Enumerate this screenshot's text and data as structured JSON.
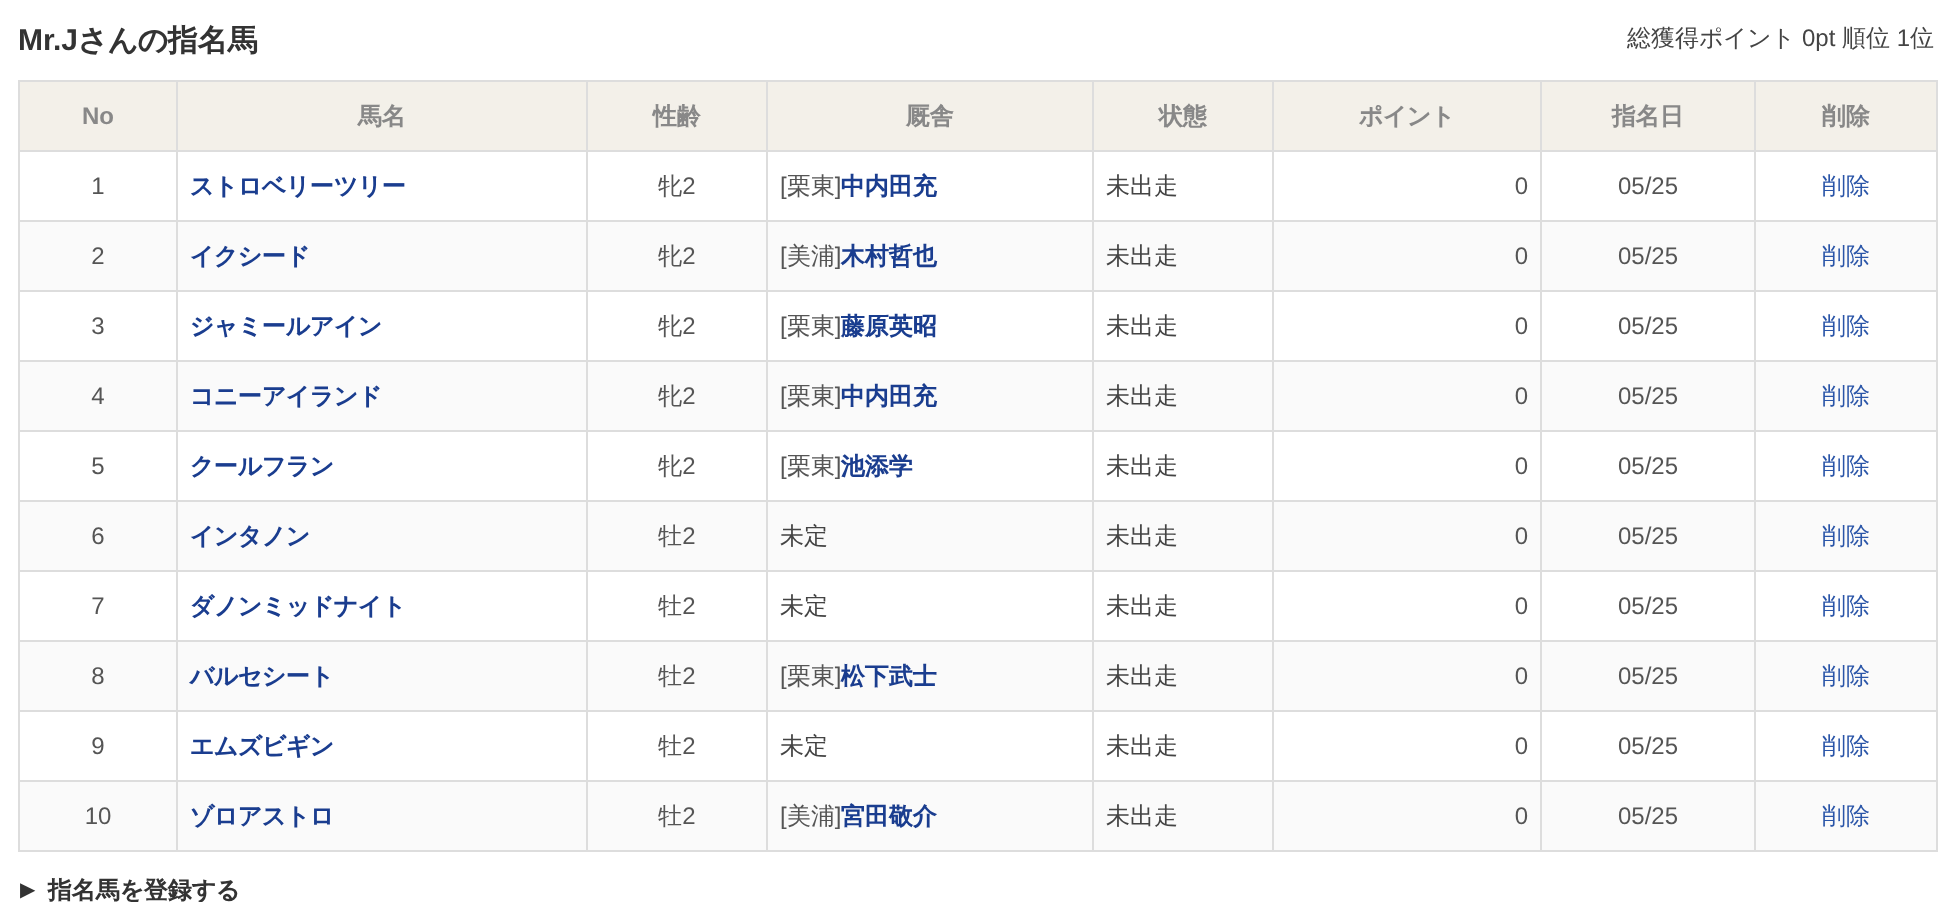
{
  "title": "Mr.Jさんの指名馬",
  "summary": "総獲得ポイント 0pt 順位 1位",
  "table": {
    "columns": [
      "No",
      "馬名",
      "性齢",
      "厩舎",
      "状態",
      "ポイント",
      "指名日",
      "削除"
    ],
    "rows": [
      {
        "no": "1",
        "horse": "ストロベリーツリー",
        "sex_age": "牝2",
        "stable": {
          "kind": "trainer",
          "region": "[栗東]",
          "trainer": "中内田充"
        },
        "status": "未出走",
        "points": "0",
        "date": "05/25",
        "delete": "削除"
      },
      {
        "no": "2",
        "horse": "イクシード",
        "sex_age": "牝2",
        "stable": {
          "kind": "trainer",
          "region": "[美浦]",
          "trainer": "木村哲也"
        },
        "status": "未出走",
        "points": "0",
        "date": "05/25",
        "delete": "削除"
      },
      {
        "no": "3",
        "horse": "ジャミールアイン",
        "sex_age": "牝2",
        "stable": {
          "kind": "trainer",
          "region": "[栗東]",
          "trainer": "藤原英昭"
        },
        "status": "未出走",
        "points": "0",
        "date": "05/25",
        "delete": "削除"
      },
      {
        "no": "4",
        "horse": "コニーアイランド",
        "sex_age": "牝2",
        "stable": {
          "kind": "trainer",
          "region": "[栗東]",
          "trainer": "中内田充"
        },
        "status": "未出走",
        "points": "0",
        "date": "05/25",
        "delete": "削除"
      },
      {
        "no": "5",
        "horse": "クールフラン",
        "sex_age": "牝2",
        "stable": {
          "kind": "trainer",
          "region": "[栗東]",
          "trainer": "池添学"
        },
        "status": "未出走",
        "points": "0",
        "date": "05/25",
        "delete": "削除"
      },
      {
        "no": "6",
        "horse": "インタノン",
        "sex_age": "牡2",
        "stable": {
          "kind": "undecided",
          "text": "未定"
        },
        "status": "未出走",
        "points": "0",
        "date": "05/25",
        "delete": "削除"
      },
      {
        "no": "7",
        "horse": "ダノンミッドナイト",
        "sex_age": "牡2",
        "stable": {
          "kind": "undecided",
          "text": "未定"
        },
        "status": "未出走",
        "points": "0",
        "date": "05/25",
        "delete": "削除"
      },
      {
        "no": "8",
        "horse": "バルセシート",
        "sex_age": "牡2",
        "stable": {
          "kind": "trainer",
          "region": "[栗東]",
          "trainer": "松下武士"
        },
        "status": "未出走",
        "points": "0",
        "date": "05/25",
        "delete": "削除"
      },
      {
        "no": "9",
        "horse": "エムズビギン",
        "sex_age": "牡2",
        "stable": {
          "kind": "undecided",
          "text": "未定"
        },
        "status": "未出走",
        "points": "0",
        "date": "05/25",
        "delete": "削除"
      },
      {
        "no": "10",
        "horse": "ゾロアストロ",
        "sex_age": "牡2",
        "stable": {
          "kind": "trainer",
          "region": "[美浦]",
          "trainer": "宮田敬介"
        },
        "status": "未出走",
        "points": "0",
        "date": "05/25",
        "delete": "削除"
      }
    ]
  },
  "footer_link": {
    "icon": "▶",
    "label": "指名馬を登録する"
  }
}
